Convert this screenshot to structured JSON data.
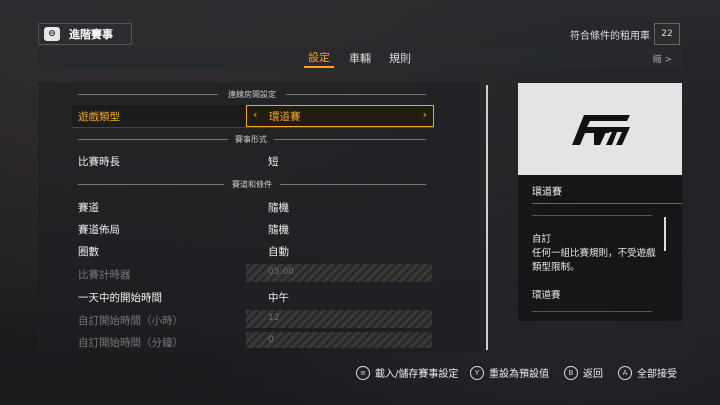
{
  "header": {
    "title": "進階賽事",
    "rental_label": "符合條件的租用車",
    "rental_count": "22"
  },
  "tabs": [
    {
      "label": "設定",
      "active": true
    },
    {
      "label": "車輛",
      "active": false
    },
    {
      "label": "規則",
      "active": false
    }
  ],
  "tab_hint": "縮 >",
  "sections": {
    "lobby": "連線房間設定",
    "format": "賽事形式",
    "track": "賽道和條件"
  },
  "rows": {
    "game_type": {
      "label": "遊戲類型",
      "value": "環道賽"
    },
    "race_length": {
      "label": "比賽時長",
      "value": "短"
    },
    "track": {
      "label": "賽道",
      "value": "隨機"
    },
    "layout": {
      "label": "賽道佈局",
      "value": "隨機"
    },
    "laps": {
      "label": "圈數",
      "value": "自動"
    },
    "timer": {
      "label": "比賽計時器",
      "value": "05:00"
    },
    "start_time": {
      "label": "一天中的開始時間",
      "value": "中午"
    },
    "custom_hour": {
      "label": "自訂開始時間（小時）",
      "value": "12"
    },
    "custom_min": {
      "label": "自訂開始時間（分鐘）",
      "value": "0"
    }
  },
  "info": {
    "title": "環道賽",
    "item1_title": "自訂",
    "item1_text": "任何一組比賽規則，不受遊戲類型限制。",
    "item2_title": "環道賽"
  },
  "footer": {
    "load_save": "載入/儲存賽事設定",
    "reset": "重設為預設值",
    "back": "返回",
    "accept_all": "全部接受"
  },
  "colors": {
    "accent": "#f3a825"
  }
}
